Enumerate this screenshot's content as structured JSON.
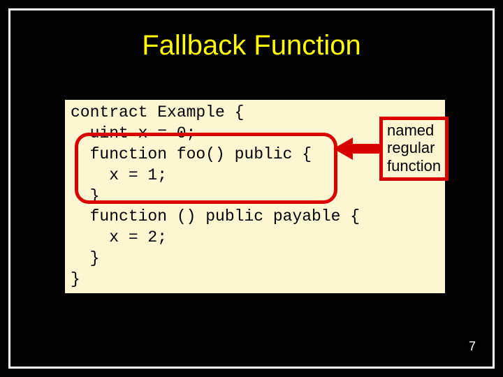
{
  "title": "Fallback Function",
  "code": {
    "l1": "contract Example {",
    "l2": "  uint x = 0;",
    "l3": "  function foo() public {",
    "l4": "    x = 1;",
    "l5": "  }",
    "l6": "  function () public payable {",
    "l7": "    x = 2;",
    "l8": "  }",
    "l9": "}"
  },
  "callout": {
    "l1": "named",
    "l2": "regular",
    "l3": "function"
  },
  "page_number": "7"
}
